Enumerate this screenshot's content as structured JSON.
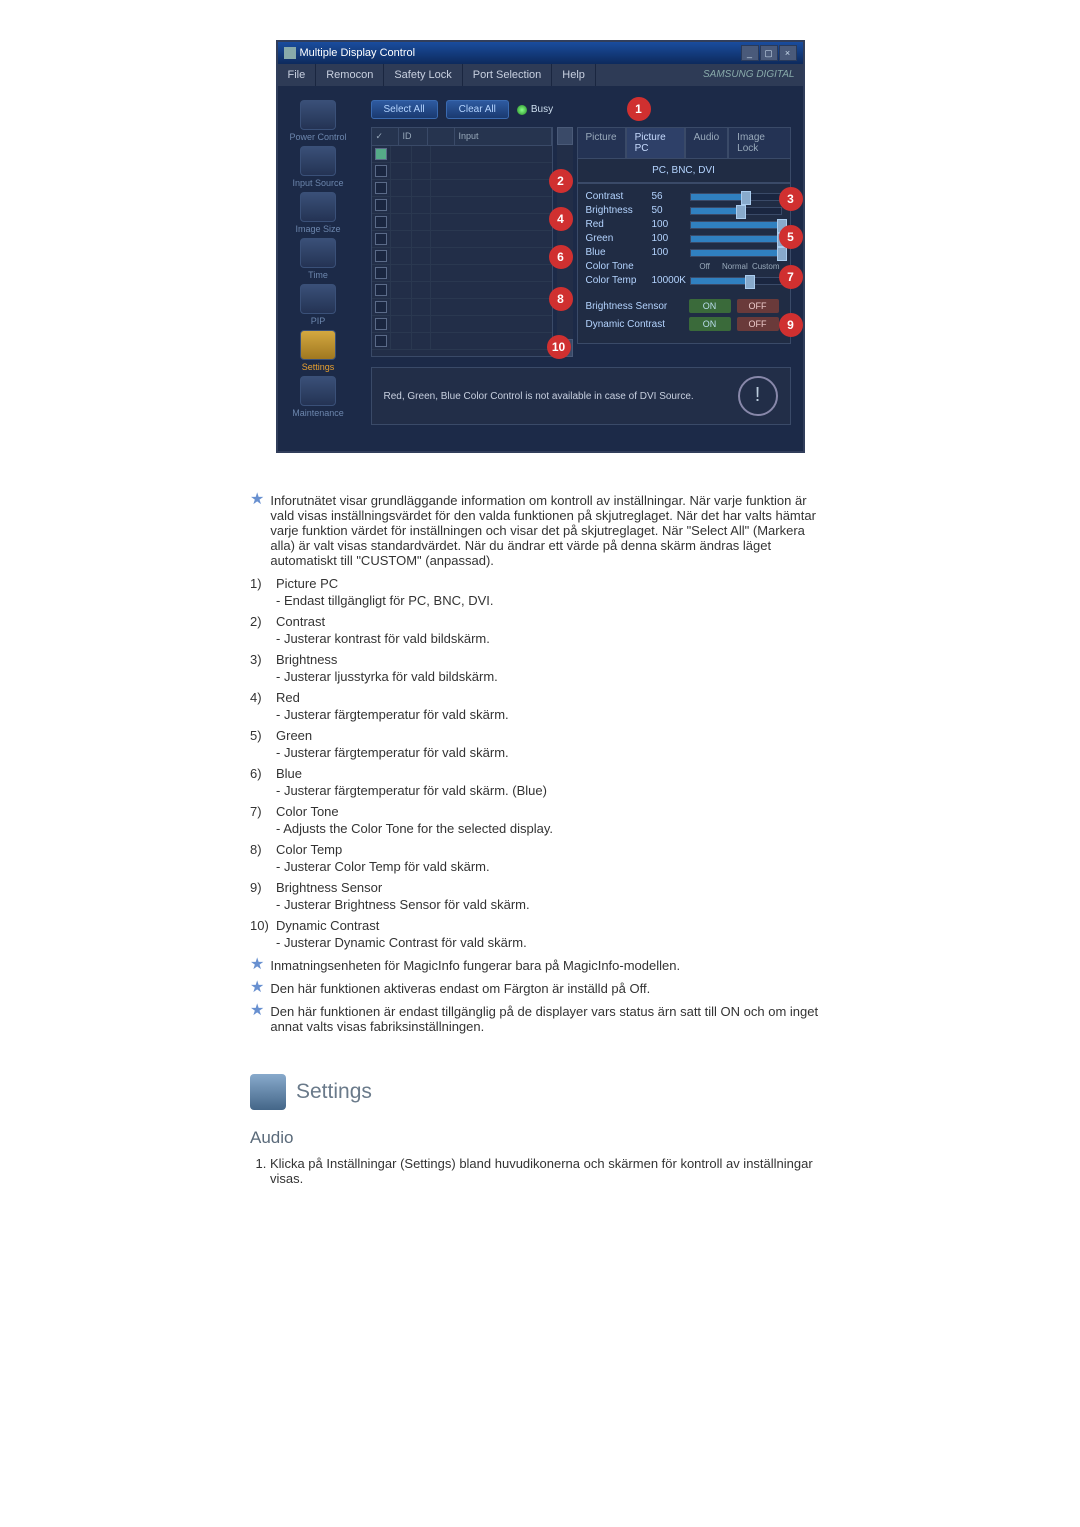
{
  "app": {
    "title": "Multiple Display Control",
    "menu": [
      "File",
      "Remocon",
      "Safety Lock",
      "Port Selection",
      "Help"
    ],
    "brand": "SAMSUNG DIGITAL",
    "select_all": "Select All",
    "clear_all": "Clear All",
    "busy": "Busy",
    "grid_headers": {
      "chk": "✓",
      "id": "ID",
      "icon": "",
      "input": "Input"
    },
    "sidebar": [
      {
        "label": "Power Control"
      },
      {
        "label": "Input Source"
      },
      {
        "label": "Image Size"
      },
      {
        "label": "Time"
      },
      {
        "label": "PIP"
      },
      {
        "label": "Settings",
        "active": true
      },
      {
        "label": "Maintenance"
      }
    ],
    "tabs": [
      "Picture",
      "Picture PC",
      "Audio",
      "Image Lock"
    ],
    "mode_label": "PC, BNC, DVI",
    "sliders": {
      "contrast": {
        "name": "Contrast",
        "val": "56"
      },
      "brightness": {
        "name": "Brightness",
        "val": "50"
      },
      "red": {
        "name": "Red",
        "val": "100"
      },
      "green": {
        "name": "Green",
        "val": "100"
      },
      "blue": {
        "name": "Blue",
        "val": "100"
      },
      "colortone": {
        "name": "Color Tone",
        "opts": [
          "Off",
          "Normal",
          "Custom"
        ]
      },
      "colortemp": {
        "name": "Color Temp",
        "val": "10000K"
      }
    },
    "toggles": {
      "bs": {
        "name": "Brightness Sensor",
        "on": "ON",
        "off": "OFF"
      },
      "dc": {
        "name": "Dynamic Contrast",
        "on": "ON",
        "off": "OFF"
      }
    },
    "status_msg": "Red, Green, Blue Color Control is not available in case of DVI Source."
  },
  "notes": {
    "intro": "Inforutnätet visar grundläggande information om kontroll av inställningar. När varje funktion är vald visas inställningsvärdet för den valda funktionen på skjutreglaget. När det har valts hämtar varje funktion värdet för inställningen och visar det på skjutreglaget. När \"Select All\" (Markera alla) är valt visas standardvärdet. När du ändrar ett värde på denna skärm ändras läget automatiskt till \"CUSTOM\" (anpassad).",
    "items": [
      {
        "n": "1)",
        "t": "Picture PC",
        "d": "- Endast tillgängligt för PC, BNC, DVI."
      },
      {
        "n": "2)",
        "t": "Contrast",
        "d": "- Justerar kontrast för vald bildskärm."
      },
      {
        "n": "3)",
        "t": "Brightness",
        "d": "- Justerar ljusstyrka för vald bildskärm."
      },
      {
        "n": "4)",
        "t": "Red",
        "d": "- Justerar färgtemperatur för vald skärm."
      },
      {
        "n": "5)",
        "t": "Green",
        "d": "- Justerar färgtemperatur för vald skärm."
      },
      {
        "n": "6)",
        "t": "Blue",
        "d": "- Justerar färgtemperatur för vald skärm. (Blue)"
      },
      {
        "n": "7)",
        "t": "Color Tone",
        "d": "- Adjusts the Color Tone for the selected display."
      },
      {
        "n": "8)",
        "t": "Color Temp",
        "d": "- Justerar Color Temp för vald skärm."
      },
      {
        "n": "9)",
        "t": "Brightness Sensor",
        "d": "- Justerar Brightness Sensor för vald skärm."
      },
      {
        "n": "10)",
        "t": "Dynamic Contrast",
        "d": "- Justerar Dynamic Contrast för vald skärm."
      }
    ],
    "foot1": "Inmatningsenheten för MagicInfo fungerar bara på MagicInfo-modellen.",
    "foot2": "Den här funktionen aktiveras endast om Färgton är inställd på Off.",
    "foot3": "Den här funktionen är endast tillgänglig på de displayer vars status ärn satt till ON och om inget annat valts visas fabriksinställningen."
  },
  "section": {
    "heading": "Settings",
    "sub": "Audio",
    "step1": "Klicka på Inställningar (Settings) bland huvudikonerna och skärmen för kontroll av inställningar visas."
  }
}
